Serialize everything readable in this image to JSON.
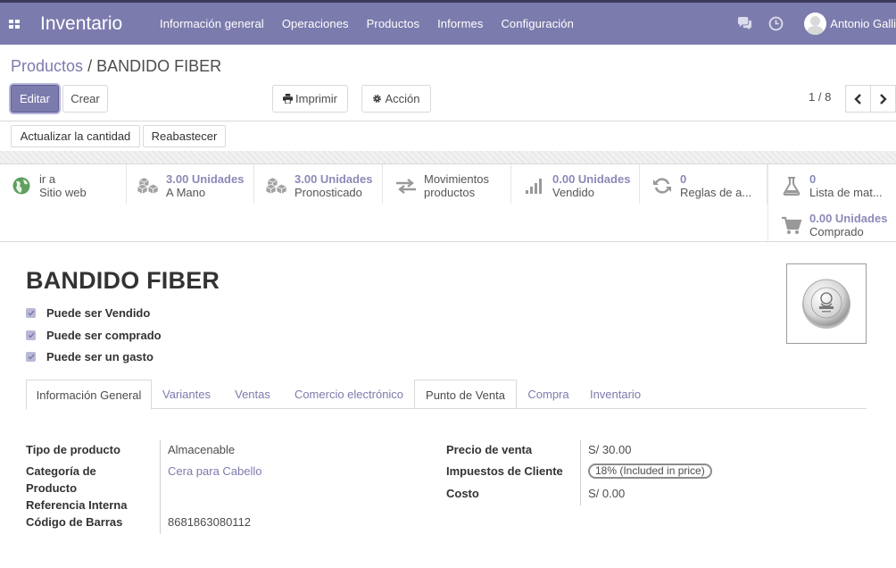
{
  "navbar": {
    "app_name": "Inventario",
    "menu": [
      "Información general",
      "Operaciones",
      "Productos",
      "Informes",
      "Configuración"
    ],
    "user_name": "Antonio Galli",
    "icons": [
      "apps-icon",
      "chat-icon",
      "clock-icon"
    ]
  },
  "breadcrumb": {
    "parent": "Productos",
    "separator": "/",
    "current": "BANDIDO FIBER"
  },
  "buttons": {
    "edit": "Editar",
    "create": "Crear",
    "print": "Imprimir",
    "action": "Acción",
    "update_qty": "Actualizar la cantidad",
    "replenish": "Reabastecer"
  },
  "pager": {
    "value": "1 / 8"
  },
  "stats": [
    {
      "value": "ir a",
      "label": "Sitio web",
      "icon": "globe-icon"
    },
    {
      "value": "3.00 Unidades",
      "label": "A Mano",
      "icon": "cubes-icon"
    },
    {
      "value": "3.00 Unidades",
      "label": "Pronosticado",
      "icon": "cubes-icon"
    },
    {
      "value": "Movimientos",
      "label": "productos",
      "icon": "exchange-icon"
    },
    {
      "value": "0.00 Unidades",
      "label": "Vendido",
      "icon": "signal-icon"
    },
    {
      "value": "0",
      "label": "Reglas de a...",
      "icon": "refresh-icon"
    },
    {
      "value": "0",
      "label": "Lista de mat...",
      "icon": "flask-icon"
    },
    {
      "value": "0.00 Unidades",
      "label": "Comprado",
      "icon": "cart-icon"
    }
  ],
  "product": {
    "name": "BANDIDO FIBER",
    "checks": [
      {
        "label": "Puede ser Vendido",
        "checked": true
      },
      {
        "label": "Puede ser comprado",
        "checked": true
      },
      {
        "label": "Puede ser un gasto",
        "checked": true
      }
    ]
  },
  "tabs": [
    "Información General",
    "Variantes",
    "Ventas",
    "Comercio electrónico",
    "Punto de Venta",
    "Compra",
    "Inventario"
  ],
  "active_tab": "Información General",
  "fields_left": [
    {
      "label": "Tipo de producto",
      "value": "Almacenable"
    },
    {
      "label": "Categoría de Producto",
      "value": "Cera para Cabello"
    },
    {
      "label": "Referencia Interna",
      "value": ""
    },
    {
      "label": "Código de Barras",
      "value": "8681863080112"
    }
  ],
  "fields_right": [
    {
      "label": "Precio de venta",
      "value": "S/ 30.00"
    },
    {
      "label": "Impuestos de Cliente",
      "value": "18% (Included in price)"
    },
    {
      "label": "Costo",
      "value": "S/ 0.00"
    }
  ],
  "colors": {
    "primary": "#7c7bad",
    "navbar_top": "#3c3b5e",
    "text": "#4c4c4c"
  }
}
